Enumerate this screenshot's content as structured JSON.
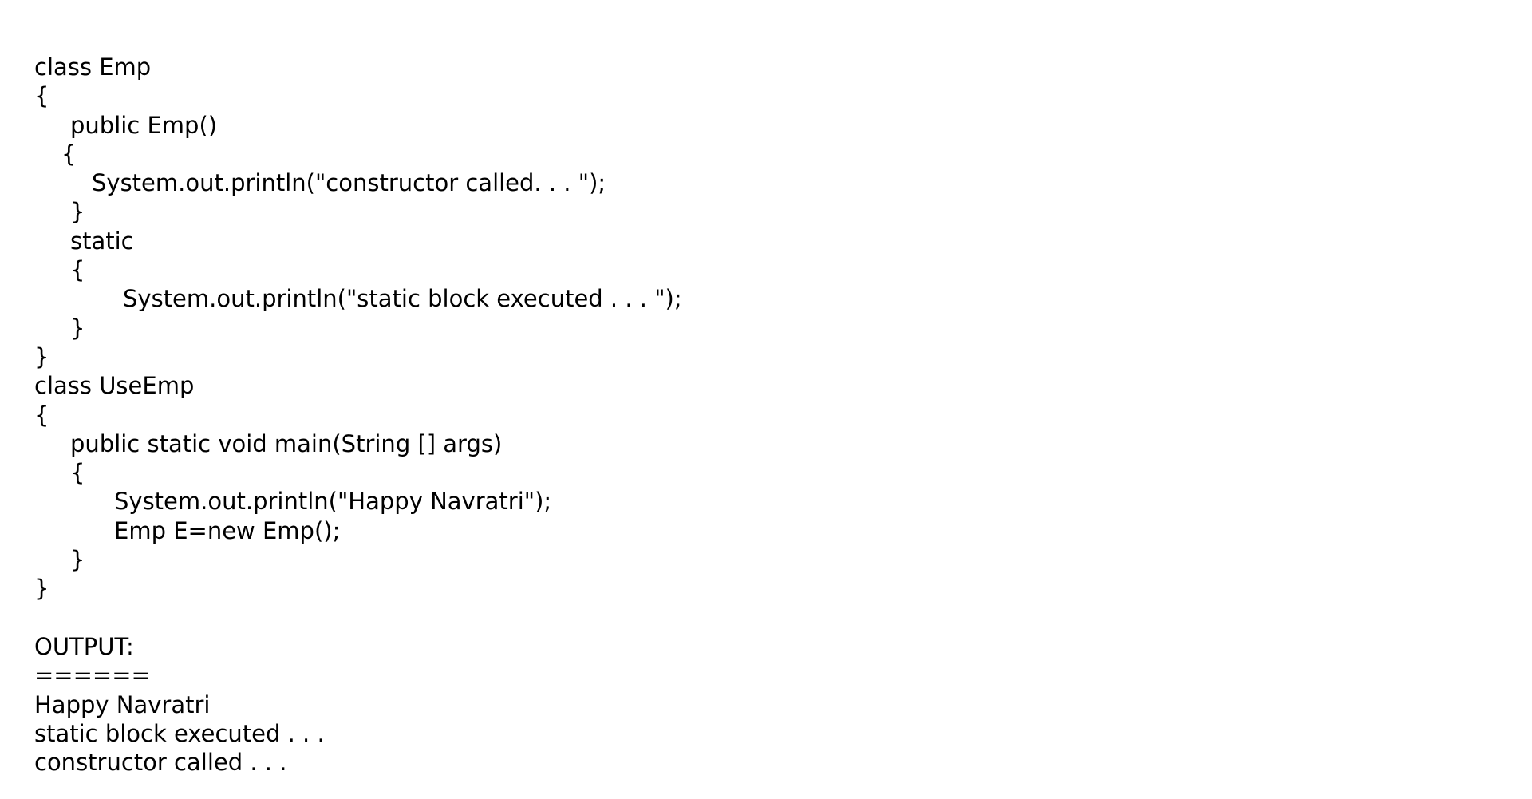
{
  "code_lines": [
    "class Emp",
    "{",
    "public Emp()",
    "{",
    "System.out.println(\"constructor called. . . \");",
    "}",
    "static",
    "{",
    "System.out.println(\"static block executed . . . \");",
    "}",
    "}",
    "class UseEmp",
    "{",
    "public static void main(String [] args)",
    "{",
    "System.out.println(\"Happy Navratri\");",
    "Emp E=new Emp();",
    "}",
    "}"
  ],
  "output": {
    "heading": "OUTPUT:",
    "underline": "======",
    "lines": [
      "Happy Navratri",
      "static block executed . . .",
      "constructor called . . ."
    ]
  }
}
